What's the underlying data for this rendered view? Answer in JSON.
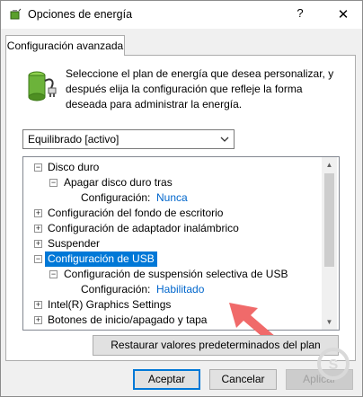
{
  "window": {
    "title": "Opciones de energía",
    "help_label": "?",
    "close_label": "✕",
    "app_icon": "power-battery-icon"
  },
  "tab": {
    "label": "Configuración avanzada"
  },
  "intro": {
    "icon": "battery-plan-icon",
    "line1": "Seleccione el plan de energía que desea personalizar, y",
    "line2": "después elija la configuración que refleje la forma",
    "line3": "deseada para administrar la energía."
  },
  "plan_select": {
    "value": "Equilibrado [activo]"
  },
  "tree": {
    "items": [
      {
        "label": "Disco duro",
        "expander": "⊟"
      },
      {
        "label": "Apagar disco duro tras",
        "expander": "⊟"
      },
      {
        "label": "Configuración:",
        "value": "Nunca"
      },
      {
        "label": "Configuración del fondo de escritorio",
        "expander": "⊞"
      },
      {
        "label": "Configuración de adaptador inalámbrico",
        "expander": "⊞"
      },
      {
        "label": "Suspender",
        "expander": "⊞"
      },
      {
        "label": "Configuración de USB",
        "expander": "⊟"
      },
      {
        "label": "Configuración de suspensión selectiva de USB",
        "expander": "⊟"
      },
      {
        "label": "Configuración:",
        "value": "Habilitado"
      },
      {
        "label": "Intel(R) Graphics Settings",
        "expander": "⊞"
      },
      {
        "label": "Botones de inicio/apagado y tapa",
        "expander": "⊞"
      }
    ]
  },
  "buttons": {
    "restore": "Restaurar valores predeterminados del plan",
    "accept": "Aceptar",
    "cancel": "Cancelar",
    "apply": "Aplicar"
  },
  "colors": {
    "selection": "#0078d7",
    "link": "#0066cc",
    "pointer_arrow": "#f06a6a"
  }
}
